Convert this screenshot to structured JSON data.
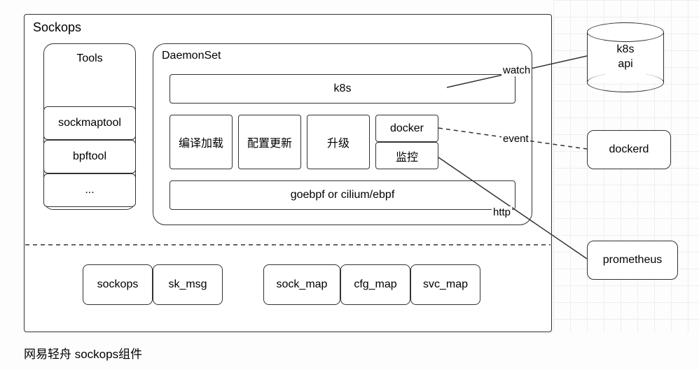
{
  "outer": {
    "title": "Sockops"
  },
  "tools": {
    "title": "Tools",
    "items": [
      "sockmaptool",
      "bpftool",
      "..."
    ]
  },
  "daemonset": {
    "title": "DaemonSet",
    "top": "k8s",
    "mods": [
      "编译加载",
      "配置更新",
      "升级"
    ],
    "docker": "docker",
    "monitor": "监控",
    "bottom": "goebpf or cilium/ebpf"
  },
  "maps": {
    "row1": [
      "sockops",
      "sk_msg"
    ],
    "row2": [
      "sock_map",
      "cfg_map",
      "svc_map"
    ]
  },
  "ext": {
    "k8sapi": "k8s\napi",
    "dockerd": "dockerd",
    "prometheus": "prometheus"
  },
  "edges": {
    "watch": "watch",
    "event": "event",
    "http": "http"
  },
  "caption": "网易轻舟 sockops组件"
}
